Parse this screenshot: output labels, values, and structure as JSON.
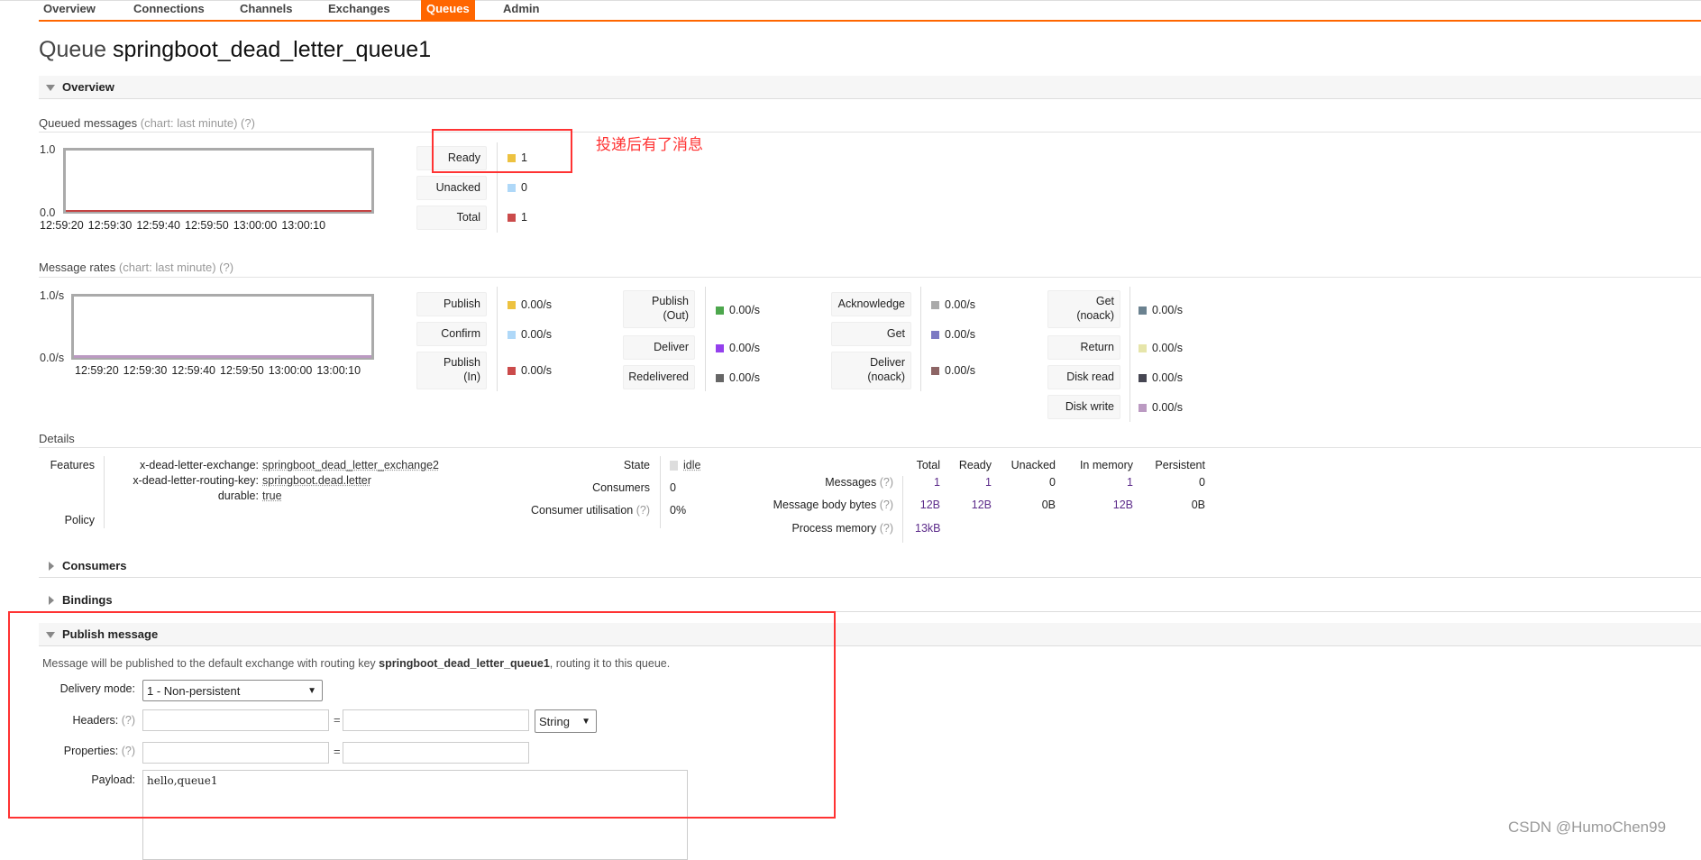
{
  "nav": {
    "tabs": [
      "Overview",
      "Connections",
      "Channels",
      "Exchanges",
      "Queues",
      "Admin"
    ],
    "active": "Queues"
  },
  "title": {
    "prefix": "Queue",
    "name": "springboot_dead_letter_queue1"
  },
  "overview": {
    "header": "Overview",
    "queued": {
      "label": "Queued messages",
      "hint": "(chart: last minute)",
      "help": "(?)",
      "chart_data": {
        "type": "line",
        "ylim": [
          0,
          1
        ],
        "yticks": [
          "1.0",
          "0.0"
        ],
        "xticks": [
          "12:59:20",
          "12:59:30",
          "12:59:40",
          "12:59:50",
          "13:00:00",
          "13:00:10"
        ],
        "series": [
          {
            "name": "Total",
            "values": [
              0,
              0,
              0,
              0,
              0,
              0
            ],
            "color": "#c44444"
          }
        ]
      },
      "legend": [
        {
          "label": "Ready",
          "value": "1",
          "color": "#edc240"
        },
        {
          "label": "Unacked",
          "value": "0",
          "color": "#afd8f8"
        },
        {
          "label": "Total",
          "value": "1",
          "color": "#cb4b4b"
        }
      ]
    },
    "annotation": "投递后有了消息",
    "rates": {
      "label": "Message rates",
      "hint": "(chart: last minute)",
      "help": "(?)",
      "chart_data": {
        "type": "line",
        "ylim": [
          0,
          1
        ],
        "yticks": [
          "1.0/s",
          "0.0/s"
        ],
        "xticks": [
          "12:59:20",
          "12:59:30",
          "12:59:40",
          "12:59:50",
          "13:00:00",
          "13:00:10"
        ]
      },
      "groups": [
        [
          {
            "label": "Publish",
            "value": "0.00/s",
            "color": "#edc240"
          },
          {
            "label": "Confirm",
            "value": "0.00/s",
            "color": "#afd8f8"
          },
          {
            "label": "Publish (In)",
            "value": "0.00/s",
            "color": "#cb4b4b"
          }
        ],
        [
          {
            "label": "Publish (Out)",
            "value": "0.00/s",
            "color": "#4da74d"
          },
          {
            "label": "Deliver",
            "value": "0.00/s",
            "color": "#9440ed"
          },
          {
            "label": "Redelivered",
            "value": "0.00/s",
            "color": "#666666"
          }
        ],
        [
          {
            "label": "Acknowledge",
            "value": "0.00/s",
            "color": "#aaaaaa"
          },
          {
            "label": "Get",
            "value": "0.00/s",
            "color": "#7c79c3"
          },
          {
            "label": "Deliver (noack)",
            "value": "0.00/s",
            "color": "#8d6565"
          }
        ],
        [
          {
            "label": "Get (noack)",
            "value": "0.00/s",
            "color": "#6b8290"
          },
          {
            "label": "Return",
            "value": "0.00/s",
            "color": "#e6e5aa"
          },
          {
            "label": "Disk read",
            "value": "0.00/s",
            "color": "#464652"
          },
          {
            "label": "Disk write",
            "value": "0.00/s",
            "color": "#bb9ac2"
          }
        ]
      ]
    },
    "details": {
      "label": "Details",
      "features_label": "Features",
      "policy_label": "Policy",
      "features": [
        {
          "key": "x-dead-letter-exchange:",
          "value": "springboot_dead_letter_exchange2"
        },
        {
          "key": "x-dead-letter-routing-key:",
          "value": "springboot.dead.letter"
        },
        {
          "key": "durable:",
          "value": "true"
        }
      ],
      "state": {
        "label": "State",
        "value": "idle"
      },
      "consumers": {
        "label": "Consumers",
        "value": "0"
      },
      "utilisation": {
        "label": "Consumer utilisation",
        "help": "(?)",
        "value": "0%"
      },
      "stats": {
        "headers": [
          "Total",
          "Ready",
          "Unacked",
          "In memory",
          "Persistent"
        ],
        "rows": [
          {
            "label": "Messages",
            "help": "(?)",
            "values": [
              "1",
              "1",
              "0",
              "1",
              "0"
            ]
          },
          {
            "label": "Message body bytes",
            "help": "(?)",
            "values": [
              "12B",
              "12B",
              "0B",
              "12B",
              "0B"
            ]
          },
          {
            "label": "Process memory",
            "help": "(?)",
            "values": [
              "13kB"
            ]
          }
        ]
      }
    }
  },
  "sections": {
    "consumers": "Consumers",
    "bindings": "Bindings",
    "publish": "Publish message"
  },
  "publish": {
    "info_pre": "Message will be published to the default exchange with routing key ",
    "info_key": "springboot_dead_letter_queue1",
    "info_post": ", routing it to this queue.",
    "delivery_label": "Delivery mode:",
    "delivery_value": "1 - Non-persistent",
    "headers_label": "Headers:",
    "properties_label": "Properties:",
    "help": "(?)",
    "eq": "=",
    "type_value": "String",
    "payload_label": "Payload:",
    "payload_value": "hello,queue1"
  },
  "watermark": "CSDN @HumoChen99"
}
